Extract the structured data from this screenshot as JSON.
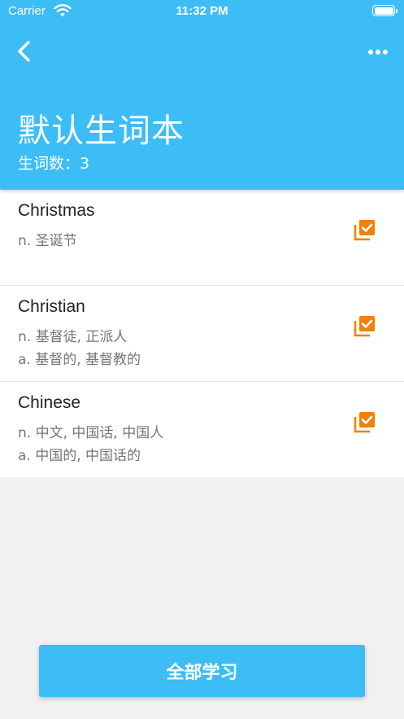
{
  "status_bar": {
    "carrier": "Carrier",
    "time": "11:32 PM"
  },
  "header": {
    "title": "默认生词本",
    "count_label": "生词数：",
    "count_value": "3",
    "back_icon": "chevron-left-icon",
    "more_icon": "more-horizontal-icon"
  },
  "words": [
    {
      "word": "Christmas",
      "defs": [
        "n. 圣诞节",
        ""
      ],
      "checked": true
    },
    {
      "word": "Christian",
      "defs": [
        "n. 基督徒, 正派人",
        "a. 基督的, 基督教的"
      ],
      "checked": true
    },
    {
      "word": "Chinese",
      "defs": [
        "n. 中文, 中国话, 中国人",
        "a. 中国的, 中国话的"
      ],
      "checked": true
    }
  ],
  "footer": {
    "study_all_label": "全部学习"
  },
  "colors": {
    "primary": "#3dbdf6",
    "check_accent": "#f0820a",
    "background": "#f1f1f1"
  }
}
